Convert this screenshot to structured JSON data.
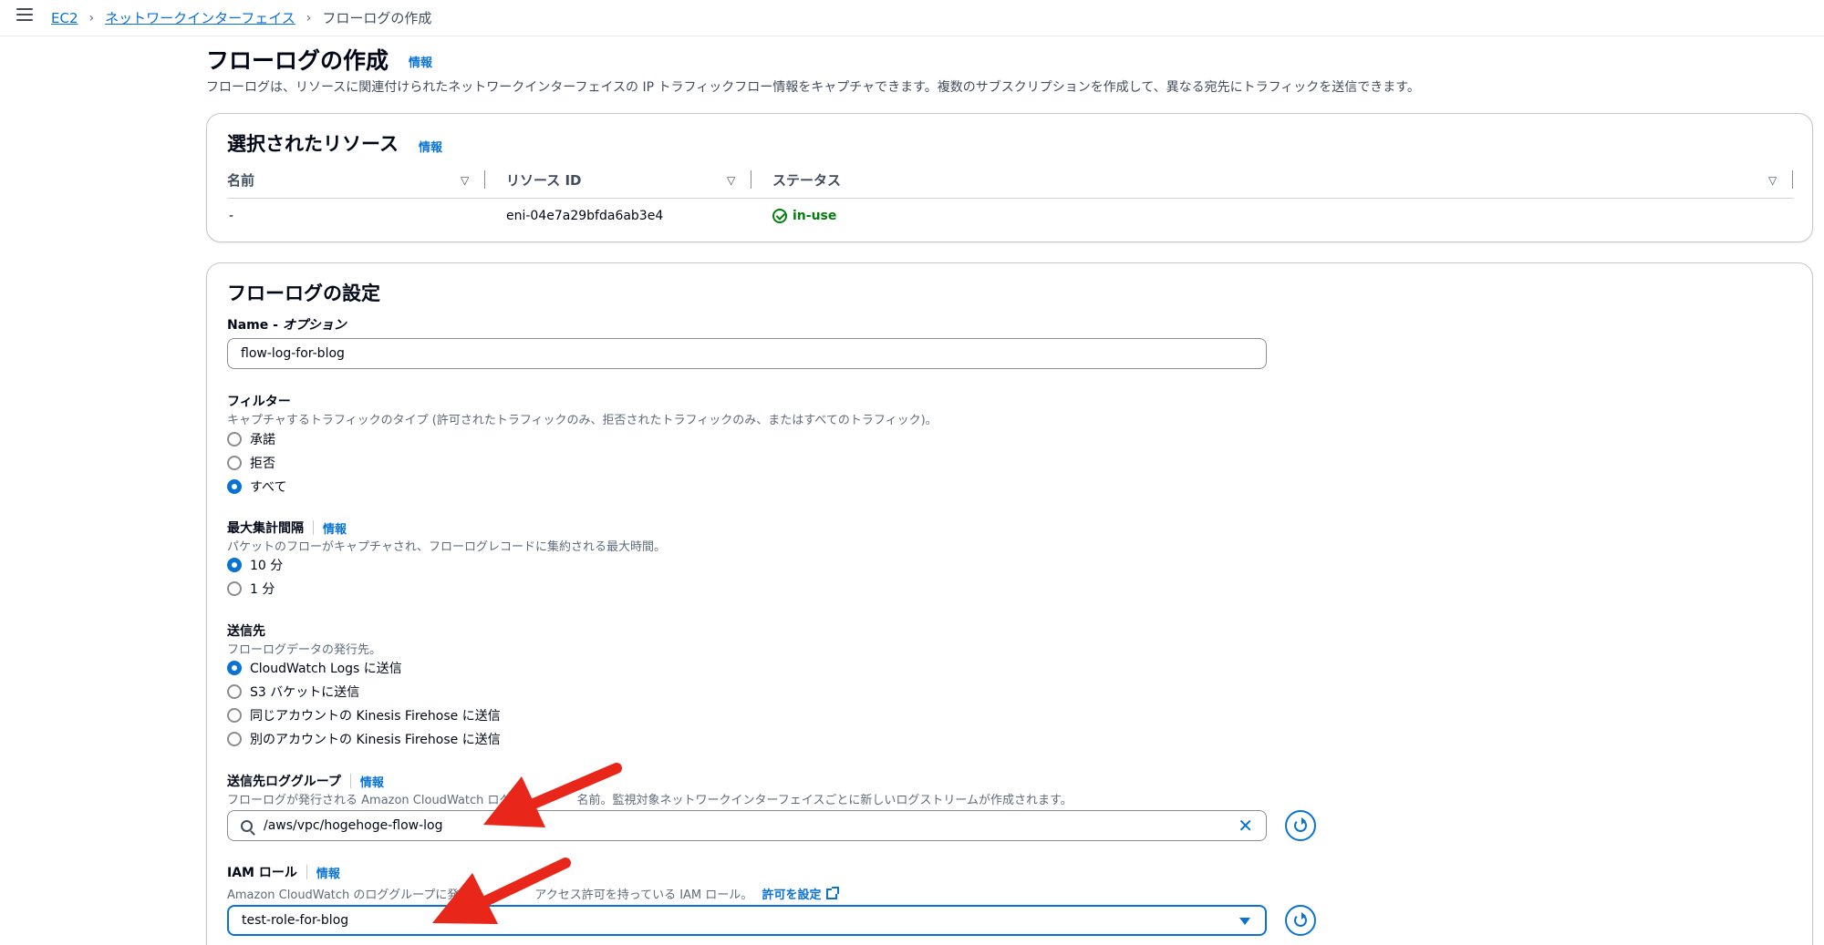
{
  "breadcrumb": {
    "items": [
      "EC2",
      "ネットワークインターフェイス"
    ],
    "current": "フローログの作成"
  },
  "page": {
    "title": "フローログの作成",
    "info": "情報",
    "description": "フローログは、リソースに関連付けられたネットワークインターフェイスの IP トラフィックフロー情報をキャプチャできます。複数のサブスクリプションを作成して、異なる宛先にトラフィックを送信できます。"
  },
  "selected_resources": {
    "title": "選択されたリソース",
    "info": "情報",
    "columns": [
      "名前",
      "リソース ID",
      "ステータス"
    ],
    "rows": [
      {
        "name": "-",
        "resource_id": "eni-04e7a29bfda6ab3e4",
        "status": "in-use"
      }
    ]
  },
  "settings": {
    "title": "フローログの設定",
    "name_label": "Name - ",
    "name_optional": "オプション",
    "name_value": "flow-log-for-blog",
    "filter": {
      "label": "フィルター",
      "description": "キャプチャするトラフィックのタイプ (許可されたトラフィックのみ、拒否されたトラフィックのみ、またはすべてのトラフィック)。",
      "options": [
        "承諾",
        "拒否",
        "すべて"
      ],
      "selected": "すべて"
    },
    "interval": {
      "label": "最大集計間隔",
      "info": "情報",
      "description": "パケットのフローがキャプチャされ、フローログレコードに集約される最大時間。",
      "options": [
        "10 分",
        "1 分"
      ],
      "selected": "10 分"
    },
    "destination": {
      "label": "送信先",
      "description": "フローログデータの発行先。",
      "options": [
        "CloudWatch Logs に送信",
        "S3 バケットに送信",
        "同じアカウントの Kinesis Firehose に送信",
        "別のアカウントの Kinesis Firehose に送信"
      ],
      "selected": "CloudWatch Logs に送信"
    },
    "log_group": {
      "label": "送信先ロググループ",
      "info": "情報",
      "description_left": "フローログが発行される Amazon CloudWatch ログ",
      "description_right": "名前。監視対象ネットワークインターフェイスごとに新しいログストリームが作成されます。",
      "value": "/aws/vpc/hogehoge-flow-log"
    },
    "iam_role": {
      "label": "IAM ロール",
      "info": "情報",
      "description_left": "Amazon CloudWatch のロググループに発行",
      "description_right": "アクセス許可を持っている IAM ロール。",
      "permission_link": "許可を設定",
      "value": "test-role-for-blog"
    }
  },
  "colors": {
    "link": "#0972d3",
    "success": "#037f0c",
    "annotation_arrow": "#e8271a"
  }
}
